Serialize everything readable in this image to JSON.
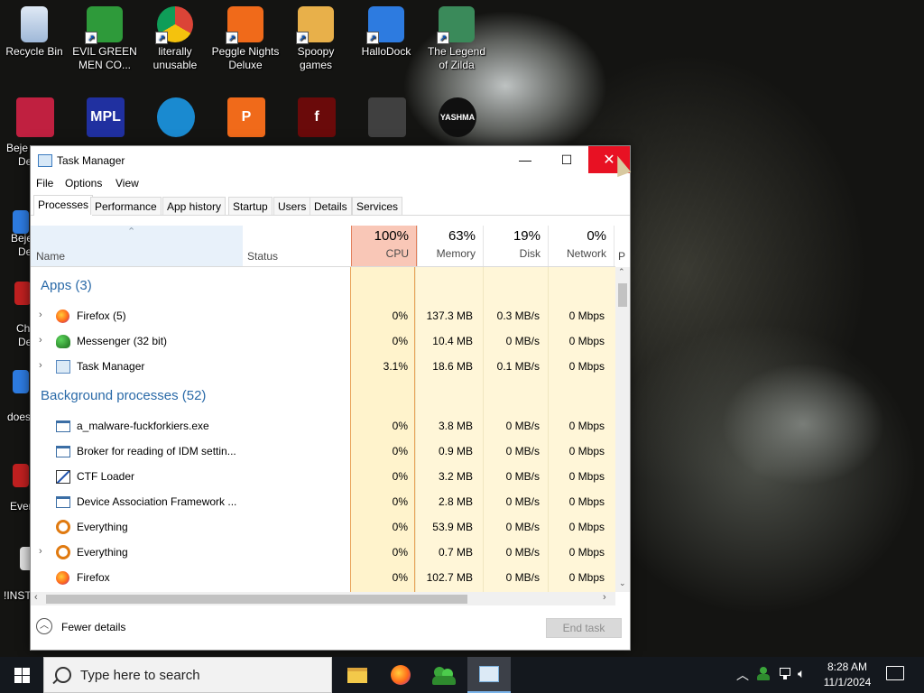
{
  "desktop": {
    "icons": [
      {
        "label": "Recycle Bin",
        "icon": "recycle-bin-icon",
        "color": "#9fb8d8"
      },
      {
        "label": "EVIL GREEN MEN CO...",
        "icon": "messenger-people-icon",
        "color": "#2e9a3a"
      },
      {
        "label": "literally unusable",
        "icon": "chrome-icon",
        "color": "#e0e0e0"
      },
      {
        "label": "Peggle Nights Deluxe",
        "icon": "peggle-icon",
        "color": "#f06a1a"
      },
      {
        "label": "Spoopy games",
        "icon": "folder-icon",
        "color": "#e8b04a"
      },
      {
        "label": "HalloDock",
        "icon": "windows-shield-icon",
        "color": "#2d7be0"
      },
      {
        "label": "The Legend of Zilda",
        "icon": "zelda-game-icon",
        "color": "#3a8a5a"
      }
    ],
    "row2_icons": [
      {
        "icon": "bejeweled-icon",
        "color": "#c02040"
      },
      {
        "icon": "mpl-icon",
        "color": "#2030a0",
        "text": "MPL"
      },
      {
        "icon": "edge-icon",
        "color": "#1a8ad0"
      },
      {
        "icon": "peggle-icon",
        "color": "#f06a1a",
        "text": "P"
      },
      {
        "icon": "flash-icon",
        "color": "#6a0a0a",
        "text": "f"
      },
      {
        "icon": "gamepad-shortcut-icon",
        "color": "#404040"
      },
      {
        "icon": "yashma-icon",
        "color": "#101010",
        "text": "YASHMA"
      }
    ],
    "partial_labels": [
      "Beje",
      "De",
      "Beje",
      "De",
      "Ch",
      "De",
      "does",
      "Ever",
      "!INST"
    ]
  },
  "window": {
    "title": "Task Manager",
    "minimize": "—",
    "maximize": "☐",
    "close": "✕"
  },
  "menu": [
    "File",
    "Options",
    "View"
  ],
  "tabs": [
    "Processes",
    "Performance",
    "App history",
    "Startup",
    "Users",
    "Details",
    "Services"
  ],
  "active_tab": "Processes",
  "columns": {
    "name": "Name",
    "status": "Status",
    "cpu": {
      "pct": "100%",
      "label": "CPU"
    },
    "memory": {
      "pct": "63%",
      "label": "Memory"
    },
    "disk": {
      "pct": "19%",
      "label": "Disk"
    },
    "network": {
      "pct": "0%",
      "label": "Network"
    },
    "power_partial": "P"
  },
  "groups": {
    "apps": "Apps (3)",
    "background": "Background processes (52)"
  },
  "apps": [
    {
      "name": "Firefox (5)",
      "icon": "firefox-icon",
      "expand": true,
      "cpu": "0%",
      "memory": "137.3 MB",
      "disk": "0.3 MB/s",
      "network": "0 Mbps"
    },
    {
      "name": "Messenger (32 bit)",
      "icon": "messenger-icon",
      "expand": true,
      "cpu": "0%",
      "memory": "10.4 MB",
      "disk": "0 MB/s",
      "network": "0 Mbps"
    },
    {
      "name": "Task Manager",
      "icon": "task-manager-icon",
      "expand": true,
      "cpu": "3.1%",
      "memory": "18.6 MB",
      "disk": "0.1 MB/s",
      "network": "0 Mbps"
    }
  ],
  "background": [
    {
      "name": "a_malware-fuckforkiers.exe",
      "icon": "window-app-icon",
      "expand": false,
      "cpu": "0%",
      "memory": "3.8 MB",
      "disk": "0 MB/s",
      "network": "0 Mbps"
    },
    {
      "name": "Broker for reading of IDM settin...",
      "icon": "window-app-icon",
      "expand": false,
      "cpu": "0%",
      "memory": "0.9 MB",
      "disk": "0 MB/s",
      "network": "0 Mbps"
    },
    {
      "name": "CTF Loader",
      "icon": "ctf-loader-icon",
      "expand": false,
      "cpu": "0%",
      "memory": "3.2 MB",
      "disk": "0 MB/s",
      "network": "0 Mbps"
    },
    {
      "name": "Device Association Framework ...",
      "icon": "window-app-icon",
      "expand": false,
      "cpu": "0%",
      "memory": "2.8 MB",
      "disk": "0 MB/s",
      "network": "0 Mbps"
    },
    {
      "name": "Everything",
      "icon": "everything-search-icon",
      "expand": false,
      "cpu": "0%",
      "memory": "53.9 MB",
      "disk": "0 MB/s",
      "network": "0 Mbps"
    },
    {
      "name": "Everything",
      "icon": "everything-search-icon",
      "expand": true,
      "cpu": "0%",
      "memory": "0.7 MB",
      "disk": "0 MB/s",
      "network": "0 Mbps"
    },
    {
      "name": "Firefox",
      "icon": "firefox-icon",
      "expand": false,
      "cpu": "0%",
      "memory": "102.7 MB",
      "disk": "0 MB/s",
      "network": "0 Mbps"
    }
  ],
  "footer": {
    "fewer_details": "Fewer details",
    "end_task": "End task"
  },
  "taskbar": {
    "search_placeholder": "Type here to search",
    "apps": [
      "file-explorer-icon",
      "firefox-icon",
      "messenger-icon",
      "task-manager-icon"
    ],
    "active_app": "task-manager-icon",
    "time": "8:28 AM",
    "date": "11/1/2024",
    "tray": [
      "chevron-up-icon",
      "messenger-tray-icon",
      "network-icon",
      "volume-icon"
    ]
  }
}
